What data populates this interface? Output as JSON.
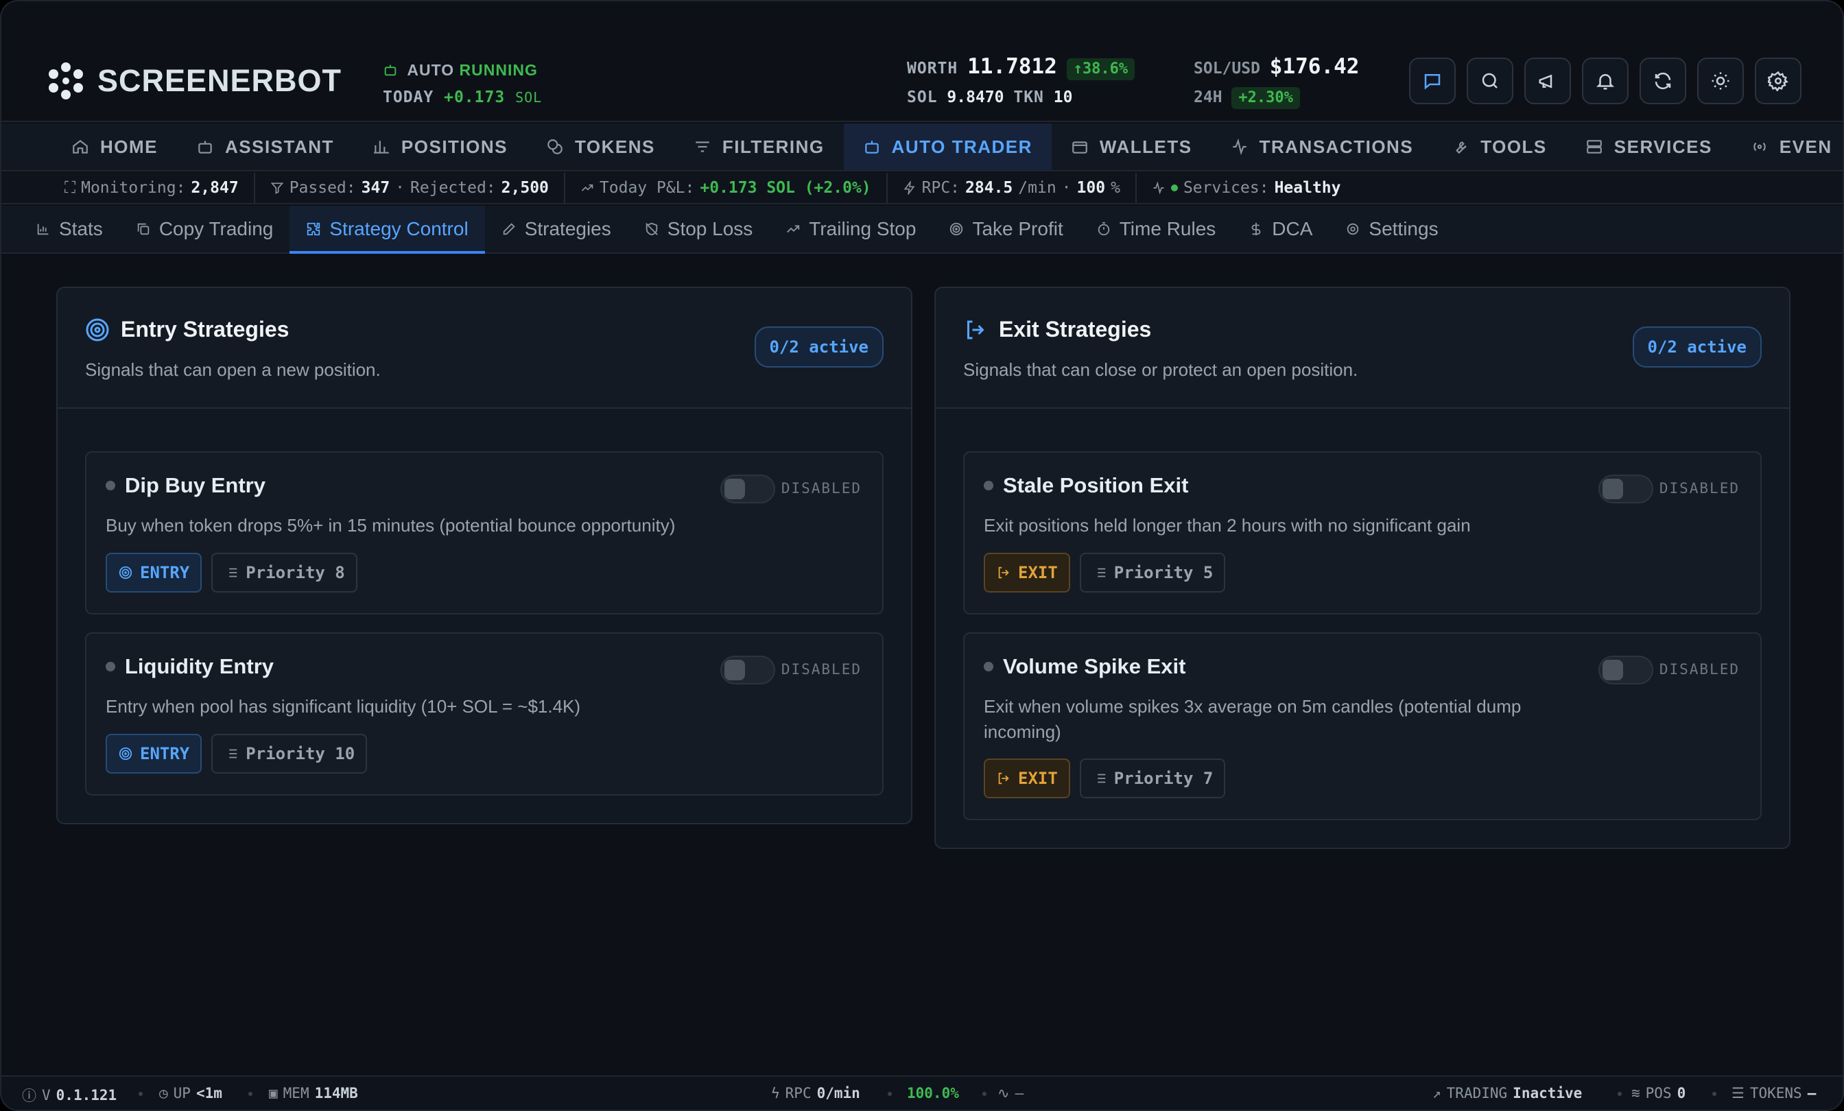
{
  "app": {
    "name": "SCREENERBOT"
  },
  "auto": {
    "label": "AUTO",
    "status": "RUNNING",
    "today_label": "TODAY",
    "today_value": "+0.173",
    "today_unit": "SOL"
  },
  "worth": {
    "label": "WORTH",
    "value": "11.7812",
    "change": "↑38.6%",
    "sol_label": "SOL",
    "sol_value": "9.8470",
    "tkn_label": "TKN",
    "tkn_value": "10"
  },
  "solusd": {
    "label": "SOL/USD",
    "value": "$176.42",
    "h24_label": "24H",
    "h24_value": "+2.30%"
  },
  "nav": [
    {
      "label": "HOME",
      "icon": "home-icon"
    },
    {
      "label": "ASSISTANT",
      "icon": "bot-icon"
    },
    {
      "label": "POSITIONS",
      "icon": "chart-icon"
    },
    {
      "label": "TOKENS",
      "icon": "coins-icon"
    },
    {
      "label": "FILTERING",
      "icon": "filter-icon"
    },
    {
      "label": "AUTO TRADER",
      "icon": "bot-icon",
      "active": true
    },
    {
      "label": "WALLETS",
      "icon": "wallet-icon"
    },
    {
      "label": "TRANSACTIONS",
      "icon": "activity-icon"
    },
    {
      "label": "TOOLS",
      "icon": "wrench-icon"
    },
    {
      "label": "SERVICES",
      "icon": "server-icon"
    },
    {
      "label": "EVEN",
      "icon": "radio-icon"
    }
  ],
  "strip": {
    "monitoring_label": "Monitoring:",
    "monitoring_value": "2,847",
    "passed_label": "Passed:",
    "passed_value": "347",
    "rejected_label": "Rejected:",
    "rejected_value": "2,500",
    "pnl_label": "Today P&L:",
    "pnl_value": "+0.173 SOL (+2.0%)",
    "rpc_label": "RPC:",
    "rpc_value": "284.5",
    "rpc_unit": "/min",
    "rpc_pct": "100",
    "services_label": "Services:",
    "services_value": "Healthy"
  },
  "subnav": [
    {
      "label": "Stats",
      "icon": "bar-chart-icon"
    },
    {
      "label": "Copy Trading",
      "icon": "copy-icon"
    },
    {
      "label": "Strategy Control",
      "icon": "puzzle-icon",
      "active": true
    },
    {
      "label": "Strategies",
      "icon": "edit-icon"
    },
    {
      "label": "Stop Loss",
      "icon": "shield-off-icon"
    },
    {
      "label": "Trailing Stop",
      "icon": "trend-icon"
    },
    {
      "label": "Take Profit",
      "icon": "target-icon"
    },
    {
      "label": "Time Rules",
      "icon": "timer-icon"
    },
    {
      "label": "DCA",
      "icon": "dollar-icon"
    },
    {
      "label": "Settings",
      "icon": "gear-icon"
    }
  ],
  "entry_panel": {
    "title": "Entry Strategies",
    "subtitle": "Signals that can open a new position.",
    "active": "0/2 active",
    "cards": [
      {
        "title": "Dip Buy Entry",
        "status": "DISABLED",
        "desc": "Buy when token drops 5%+ in 15 minutes (potential bounce opportunity)",
        "kind": "ENTRY",
        "priority": "Priority 8"
      },
      {
        "title": "Liquidity Entry",
        "status": "DISABLED",
        "desc": "Entry when pool has significant liquidity (10+ SOL = ~$1.4K)",
        "kind": "ENTRY",
        "priority": "Priority 10"
      }
    ]
  },
  "exit_panel": {
    "title": "Exit Strategies",
    "subtitle": "Signals that can close or protect an open position.",
    "active": "0/2 active",
    "cards": [
      {
        "title": "Stale Position Exit",
        "status": "DISABLED",
        "desc": "Exit positions held longer than 2 hours with no significant gain",
        "kind": "EXIT",
        "priority": "Priority 5"
      },
      {
        "title": "Volume Spike Exit",
        "status": "DISABLED",
        "desc": "Exit when volume spikes 3x average on 5m candles (potential dump incoming)",
        "kind": "EXIT",
        "priority": "Priority 7"
      }
    ]
  },
  "bottom": {
    "version_label": "V",
    "version": "0.1.121",
    "up_label": "UP",
    "up_value": "<1m",
    "mem_label": "MEM",
    "mem_value": "114MB",
    "rpc_label": "RPC",
    "rpc_value": "0/min",
    "rpc_pct": "100.0%",
    "pulse": "–",
    "trading_label": "TRADING",
    "trading_value": "Inactive",
    "pos_label": "POS",
    "pos_value": "0",
    "tokens_label": "TOKENS",
    "tokens_value": "–"
  },
  "colors": {
    "accent": "#58a6ff",
    "green": "#3fb950",
    "exit": "#e3a33a",
    "bg": "#0d1117"
  }
}
